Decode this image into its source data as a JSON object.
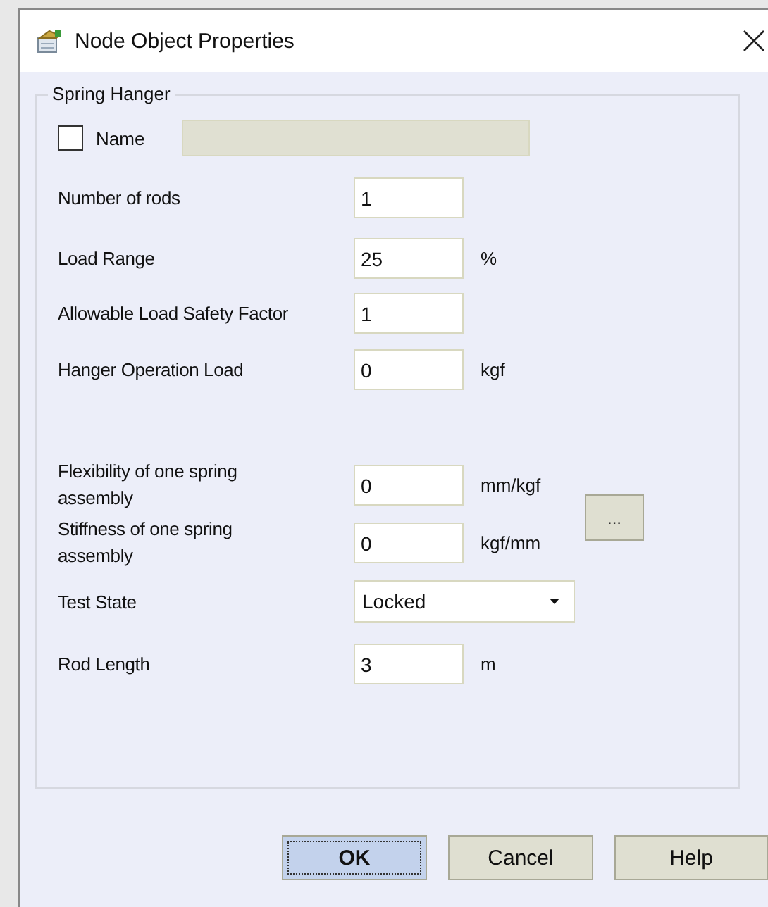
{
  "window": {
    "title": "Node Object Properties"
  },
  "group": {
    "title": "Spring Hanger"
  },
  "name_row": {
    "label": "Name",
    "checked": false,
    "disabled": true
  },
  "fields": [
    {
      "kind": "text",
      "label": "Number of rods",
      "value": "1"
    },
    {
      "kind": "text",
      "label": "Load Range",
      "value": "25",
      "unit": "%"
    },
    {
      "kind": "text",
      "label": "Allowable Load Safety Factor",
      "value": "1"
    },
    {
      "kind": "text",
      "label": "Hanger Operation Load",
      "value": "0",
      "unit": "kgf"
    },
    {
      "kind": "text",
      "label": "Flexibility of one spring assembly",
      "value": "0",
      "unit": "mm/kgf"
    },
    {
      "kind": "text",
      "label": "Stiffness of one spring assembly",
      "value": "0",
      "unit": "kgf/mm"
    },
    {
      "kind": "dropdown",
      "label": "Test State",
      "value": "Locked"
    },
    {
      "kind": "text",
      "label": "Rod Length",
      "value": "3",
      "unit": "m"
    }
  ],
  "browse_button": "...",
  "buttons": [
    {
      "label": "OK",
      "default": true
    },
    {
      "label": "Cancel",
      "default": false
    },
    {
      "label": "Help",
      "default": false
    }
  ]
}
